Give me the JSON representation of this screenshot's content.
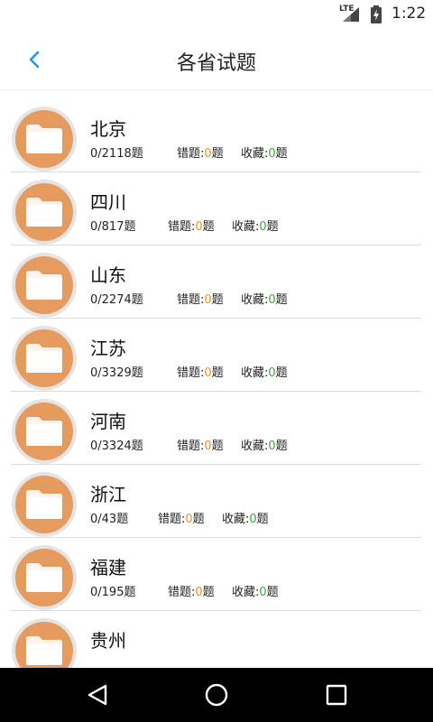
{
  "status_bar": {
    "network": "LTE",
    "time": "1:22"
  },
  "header": {
    "title": "各省试题"
  },
  "labels": {
    "wrong": "错题:",
    "favorite": "收藏:",
    "unit_space": " 题",
    "unit": "题"
  },
  "colors": {
    "accent": "#2196f3",
    "folder": "#e59a5e",
    "wrong_count": "#f0902a",
    "favorite_count": "#3aaa3a"
  },
  "provinces": [
    {
      "name": "北京",
      "progress": "0/2118",
      "wrong": "0",
      "favorite": "0"
    },
    {
      "name": "四川",
      "progress": "0/817",
      "wrong": "0",
      "favorite": "0"
    },
    {
      "name": "山东",
      "progress": "0/2274",
      "wrong": "0",
      "favorite": "0"
    },
    {
      "name": "江苏",
      "progress": "0/3329",
      "wrong": "0",
      "favorite": "0"
    },
    {
      "name": "河南",
      "progress": "0/3324",
      "wrong": "0",
      "favorite": "0"
    },
    {
      "name": "浙江",
      "progress": "0/43",
      "wrong": "0",
      "favorite": "0"
    },
    {
      "name": "福建",
      "progress": "0/195",
      "wrong": "0",
      "favorite": "0"
    },
    {
      "name": "贵州",
      "progress": "",
      "wrong": "",
      "favorite": ""
    }
  ],
  "nav": {
    "icons": [
      "back-triangle-icon",
      "home-circle-icon",
      "recents-square-icon"
    ]
  }
}
